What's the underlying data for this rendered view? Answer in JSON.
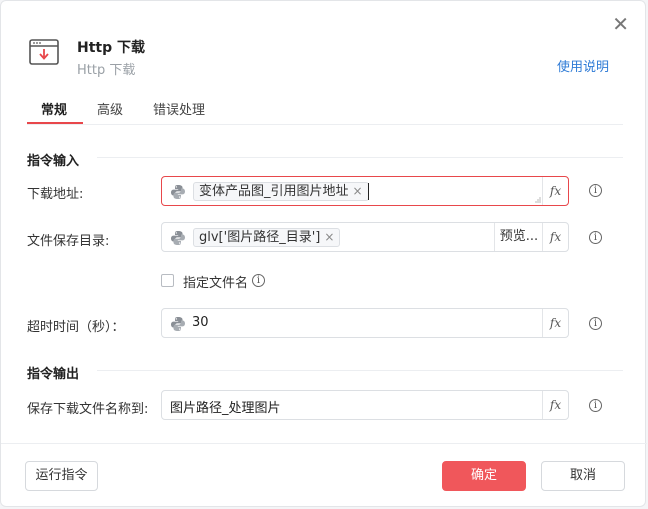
{
  "dialog": {
    "title": "Http 下载",
    "subtitle": "Http 下载",
    "help_link": "使用说明",
    "close_glyph": "✕"
  },
  "tabs": [
    {
      "label": "常规",
      "active": true
    },
    {
      "label": "高级",
      "active": false
    },
    {
      "label": "错误处理",
      "active": false
    }
  ],
  "input_section": {
    "heading": "指令输入",
    "download_url": {
      "label": "下载地址:",
      "tag": "变体产品图_引用图片地址",
      "state": "error"
    },
    "save_dir": {
      "label": "文件保存目录:",
      "tag": "glv['图片路径_目录']",
      "preview_label": "预览..."
    },
    "specify_filename": {
      "label": "指定文件名",
      "checked": false
    },
    "timeout": {
      "label": "超时时间（秒）：",
      "value": "30"
    }
  },
  "output_section": {
    "heading": "指令输出",
    "save_name": {
      "label": "保存下载文件名称到:",
      "value": "图片路径_处理图片"
    }
  },
  "fx_label": "fx",
  "info_glyph": "i",
  "tag_close_glyph": "×",
  "footer": {
    "run_label": "运行指令",
    "ok_label": "确定",
    "cancel_label": "取消"
  },
  "colors": {
    "accent": "#f0575b",
    "link": "#2f7bd6",
    "error_border": "#e8474b"
  },
  "icons": [
    "download-window-icon",
    "python-icon",
    "fx-icon",
    "info-icon",
    "close-icon"
  ]
}
